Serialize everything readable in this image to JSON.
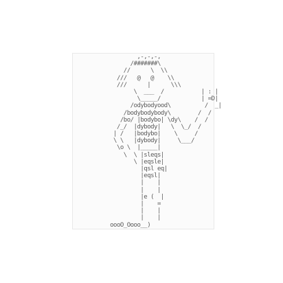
{
  "art": {
    "lines": [
      "                   ,-,-,-,",
      "                 /#######\\",
      "               //      \\  \\\\",
      "             ///   @   @    \\\\",
      "             ///      |      \\\\\\",
      "                  \\  ___  /           | : |",
      "                   \\_____/            | =D|",
      "                 /odybodyood\\          /  _|",
      "               /bodybodybody\\        /  /",
      "              /bo/ |bodybo| \\dy\\    /  /",
      "             /_/  |dybody|   \\  \\_/  /",
      "            | /   |bodybo|    \\     /",
      "            \\ \\   |dybody|     \\___/",
      "             \\o \\  |_____|",
      "               \\  \\ |sleqs|",
      "                  \\ |eqsle|",
      "                    |qsl eq|",
      "                    |eqsl|",
      "                    |    |",
      "                    |    |",
      "                    |e (  |",
      "                    |    =",
      "                    |    |",
      "                    |    |",
      "           oooO_Oooo__)"
    ]
  }
}
